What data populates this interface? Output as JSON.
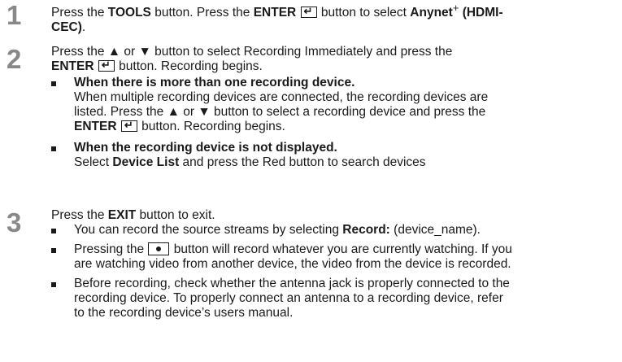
{
  "steps": [
    {
      "number": "1",
      "lines": [
        {
          "a": "Press the ",
          "b1": "TOOLS",
          "c": " button. Press the ",
          "b2": "ENTER",
          "d": " button to select ",
          "b3": "Anynet",
          "sup": "+",
          "b4": " (HDMI-"
        },
        {
          "b": "CEC)",
          "t": "."
        }
      ]
    },
    {
      "number": "2",
      "line1": "Press the ▲ or ▼ button to select Recording Immediately and press the",
      "line2_b": "ENTER",
      "line2_t": " button. Recording begins.",
      "bullets": [
        {
          "title": "When there is more than one recording device.",
          "l1": "When multiple recording devices are connected, the recording devices are",
          "l2": "listed. Press the ▲ or ▼ button to select a recording device and press the",
          "l3_b": "ENTER",
          "l3_t": " button. Recording begins."
        },
        {
          "title": "When the recording device is not displayed.",
          "l1_a": "Select ",
          "l1_b": "Device List",
          "l1_c": " and press the Red button to search devices"
        }
      ]
    },
    {
      "number": "3",
      "line1_a": "Press the ",
      "line1_b": "EXIT",
      "line1_c": " button to exit.",
      "bullets": [
        {
          "a": "You can record the source streams by selecting ",
          "b": "Record:",
          "c": " (device_name)."
        },
        {
          "a": "Pressing the ",
          "c": " button will record whatever you are currently watching. If you",
          "l2": "are watching video from another device, the video from the device is recorded."
        },
        {
          "l1": "Before recording, check whether the antenna jack is properly connected to the",
          "l2": "recording device. To properly connect an antenna to a recording device, refer",
          "l3": "to the recording device’s users manual."
        }
      ]
    }
  ]
}
